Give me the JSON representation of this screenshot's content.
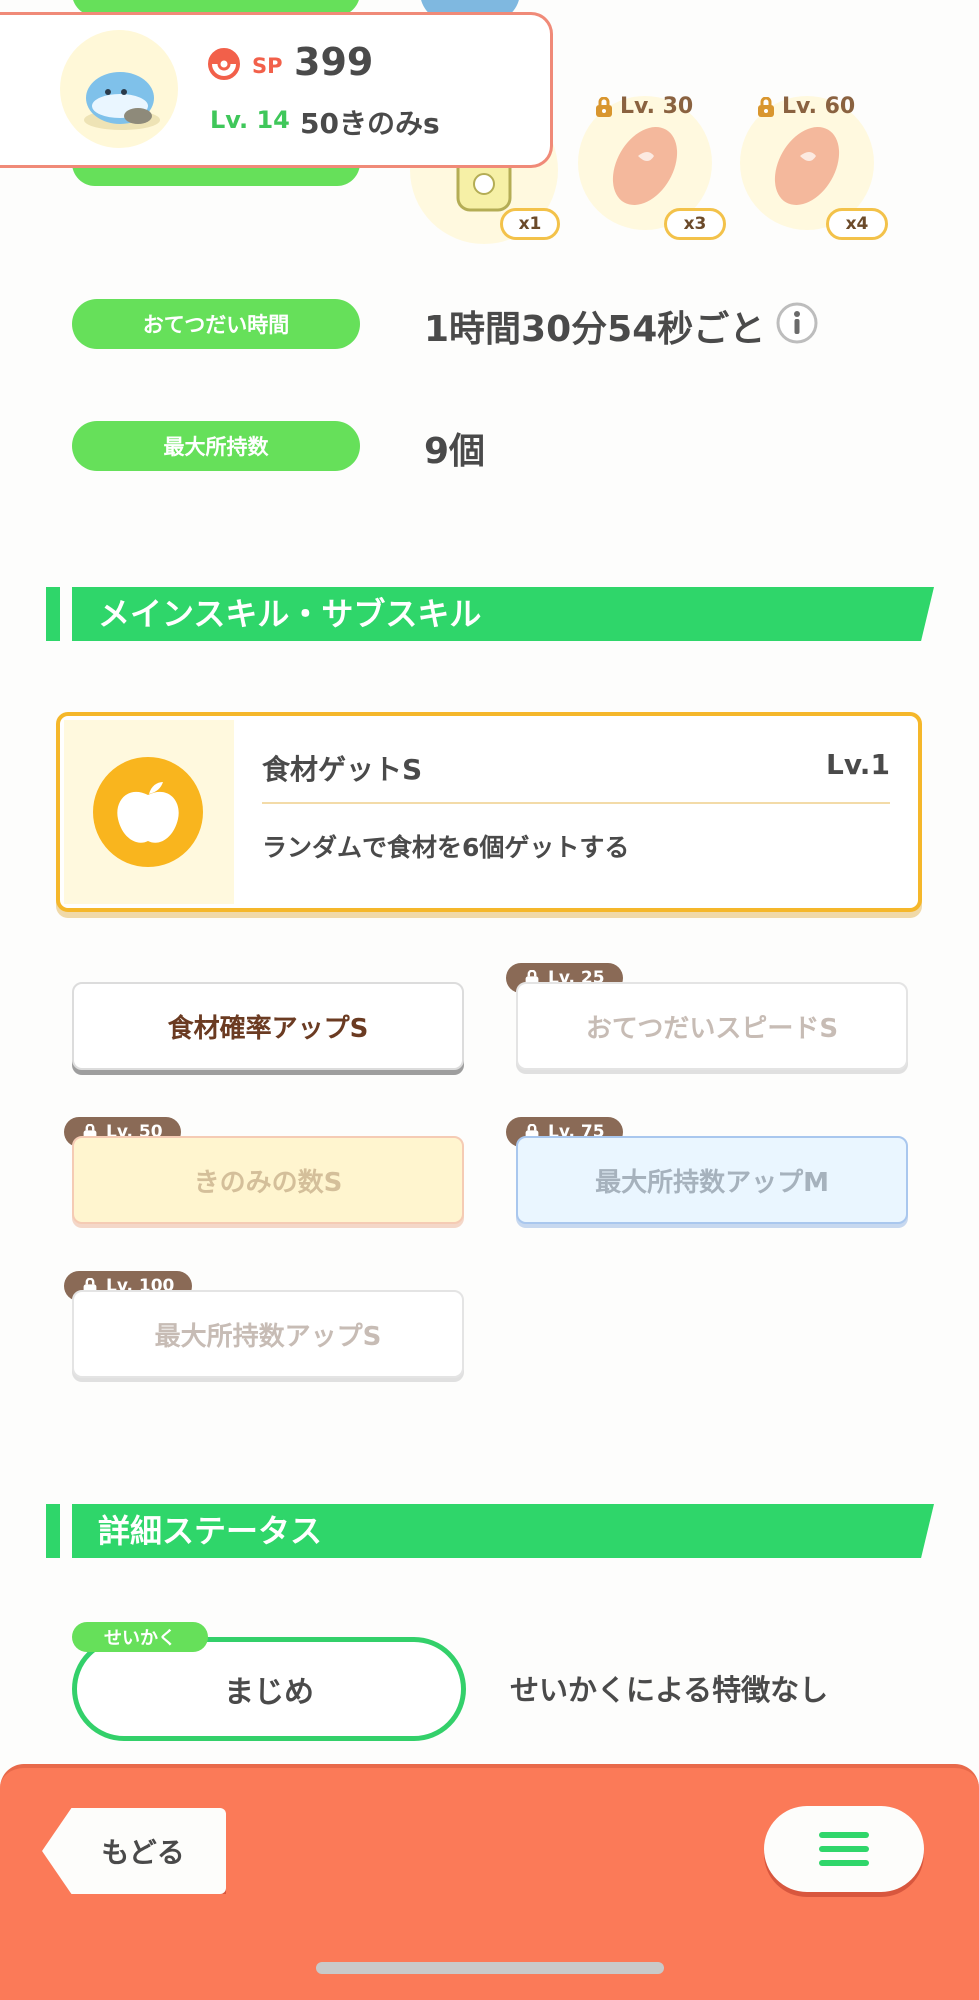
{
  "header": {
    "sp_label": "SP",
    "sp_value": "399",
    "level_label": "Lv. 14",
    "berries_text": "50きのみs"
  },
  "ingredients": [
    {
      "count": "x1",
      "locked": false
    },
    {
      "lock_level": "Lv. 30",
      "count": "x3",
      "locked": true
    },
    {
      "lock_level": "Lv. 60",
      "count": "x4",
      "locked": true
    }
  ],
  "stats": {
    "help_time_label": "おてつだい時間",
    "help_time_value": "1時間30分54秒ごと",
    "max_carry_label": "最大所持数",
    "max_carry_value": "9個"
  },
  "skills_section": {
    "title": "メインスキル・サブスキル",
    "main_skill": {
      "name": "食材ゲットS",
      "level": "Lv.1",
      "description": "ランダムで食材を6個ゲットする"
    },
    "sub_skills": [
      {
        "lock_level": "",
        "name": "食材確率アップS",
        "unlocked": true
      },
      {
        "lock_level": "Lv. 25",
        "name": "おてつだいスピードS",
        "unlocked": false
      },
      {
        "lock_level": "Lv. 50",
        "name": "きのみの数S",
        "unlocked": false
      },
      {
        "lock_level": "Lv. 75",
        "name": "最大所持数アップM",
        "unlocked": false
      },
      {
        "lock_level": "Lv. 100",
        "name": "最大所持数アップS",
        "unlocked": false
      }
    ]
  },
  "details_section": {
    "title": "詳細ステータス",
    "nature_tag": "せいかく",
    "nature_value": "まじめ",
    "nature_effect": "せいかくによる特徴なし"
  },
  "footer": {
    "back_label": "もどる"
  },
  "colors": {
    "accent_green": "#66e05a",
    "section_green": "#2fd66a",
    "footer_orange": "#fb7a58",
    "skill_gold": "#f5b72a",
    "lock_brown": "#8a6a56"
  },
  "icons": {
    "pokeball": "pokeball-icon",
    "info": "info-icon",
    "lock": "lock-icon",
    "apple": "apple-icon",
    "menu": "hamburger-menu-icon"
  }
}
